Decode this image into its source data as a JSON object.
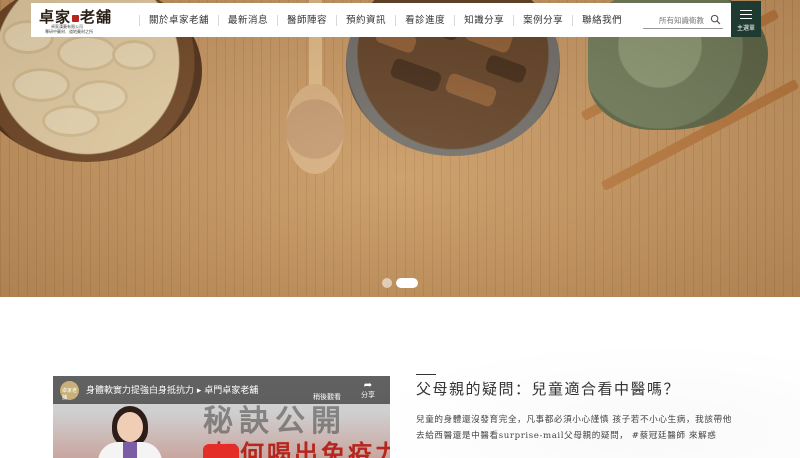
{
  "header": {
    "logo": {
      "main_left": "卓家",
      "main_right": "老舖",
      "sub1": "卓家漢藥有限公司",
      "sub2": "專研中藥材．道地藥材之所"
    },
    "nav": [
      {
        "label": "關於卓家老舖"
      },
      {
        "label": "最新消息"
      },
      {
        "label": "醫師陣容"
      },
      {
        "label": "預約資訊"
      },
      {
        "label": "看診進度"
      },
      {
        "label": "知識分享"
      },
      {
        "label": "案例分享"
      },
      {
        "label": "聯絡我們"
      }
    ],
    "search": {
      "placeholder": "所有知識衛教",
      "icon": "search-icon"
    },
    "menu": {
      "label": "主選單",
      "icon": "hamburger-icon"
    }
  },
  "hero": {
    "carousel": {
      "slides": 2,
      "active": 2
    }
  },
  "video": {
    "channel": "卓家老舖",
    "title": "身體軟實力提強白身抵抗力 ▸ 卓門卓家老舖",
    "watch_later": "稍後觀看",
    "share": "分享",
    "big_text": "秘訣公開",
    "overlay_text": "如何喝出免疫力"
  },
  "article": {
    "title": "父母親的疑問：兒童適合看中醫嗎？",
    "body": "兒童的身體還沒發育完全，凡事都必須小心謹慎 孩子若不小心生病，我該帶他去給西醫還是中醫看surprise-mail父母親的疑問， #蔡冠廷醫師 來解惑"
  },
  "colors": {
    "accent": "#1f3a30",
    "brand_red": "#b5261e",
    "text": "#333333"
  }
}
